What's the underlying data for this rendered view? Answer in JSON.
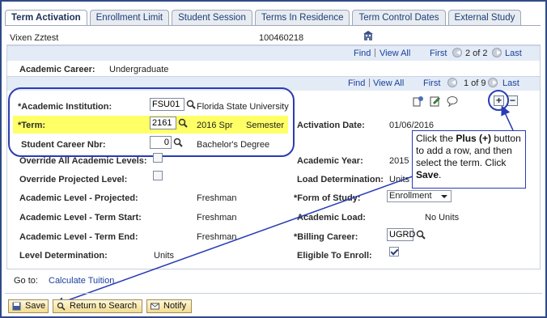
{
  "tabs": [
    "Term Activation",
    "Enrollment Limit",
    "Student Session",
    "Terms In Residence",
    "Term Control Dates",
    "External Study"
  ],
  "header": {
    "name": "Vixen Zztest",
    "id": "100460218"
  },
  "nav1": {
    "find": "Find",
    "view_all": "View All",
    "first": "First",
    "count": "2 of 2",
    "last": "Last"
  },
  "career": {
    "label": "Academic Career:",
    "value": "Undergraduate"
  },
  "nav2": {
    "find": "Find",
    "view_all": "View All",
    "first": "First",
    "count": "1 of 9",
    "last": "Last"
  },
  "institution": {
    "label": "*Academic Institution:",
    "code": "FSU01",
    "name": "Florida State University"
  },
  "term": {
    "label": "*Term:",
    "code": "2161",
    "name": "2016 Spr",
    "type": "Semester"
  },
  "career_nbr": {
    "label": "Student Career Nbr:",
    "value": "0",
    "desc": "Bachelor's Degree"
  },
  "activation": {
    "label": "Activation Date:",
    "value": "01/06/2016"
  },
  "override_levels": {
    "label": "Override All Academic Levels:",
    "checked": false
  },
  "override_projected": {
    "label": "Override Projected Level:",
    "checked": false
  },
  "academic_year": {
    "label": "Academic Year:",
    "value": "2015"
  },
  "load_det": {
    "label": "Load Determination:",
    "value": "Units"
  },
  "level_projected": {
    "label": "Academic Level - Projected:",
    "value": "Freshman"
  },
  "form_of_study": {
    "label": "*Form of Study:",
    "value": "Enrollment"
  },
  "level_start": {
    "label": "Academic Level - Term Start:",
    "value": "Freshman"
  },
  "academic_load": {
    "label": "Academic Load:",
    "value": "No Units"
  },
  "level_end": {
    "label": "Academic Level - Term End:",
    "value": "Freshman"
  },
  "billing": {
    "label": "*Billing Career:",
    "value": "UGRD"
  },
  "level_det": {
    "label": "Level Determination:",
    "value": "Units"
  },
  "eligible": {
    "label": "Eligible To Enroll:",
    "checked": true
  },
  "goto": {
    "label": "Go to:",
    "link": "Calculate Tuition"
  },
  "buttons": {
    "save": "Save",
    "return": "Return to Search",
    "notify": "Notify"
  },
  "callout": {
    "t1": "Click the ",
    "b1": "Plus (+)",
    "t2": " button to add a row, and then select the term. Click ",
    "b2": "Save",
    "t3": "."
  },
  "colors": {
    "highlight": "#ffff66",
    "annotation": "#2a3cb4",
    "tab_text": "#1b3f7a"
  }
}
